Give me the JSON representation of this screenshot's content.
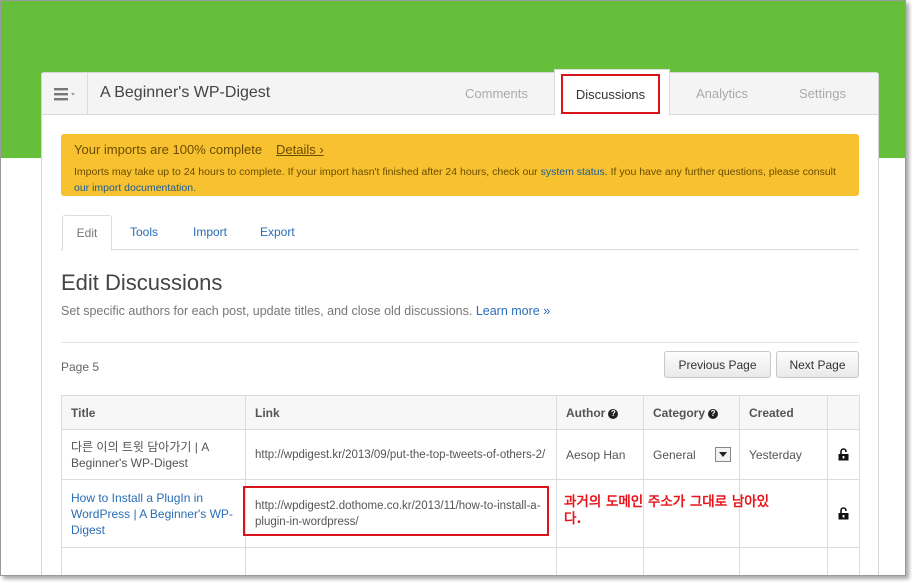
{
  "header": {
    "site_title": "A Beginner's WP-Digest",
    "tabs": [
      {
        "label": "Comments"
      },
      {
        "label": "Discussions"
      },
      {
        "label": "Analytics"
      },
      {
        "label": "Settings"
      }
    ],
    "active_tab": "Discussions"
  },
  "alert": {
    "title": "Your imports are 100% complete",
    "details_link": "Details ›",
    "body_part1": "Imports may take up to 24 hours to complete. If your import hasn't finished after 24 hours, check our ",
    "system_status_link": "system status",
    "body_part2": ". If you have any further questions, please consult ",
    "import_docs_link": "our import documentation",
    "body_part3": ".",
    "background_color": "#f8c12f"
  },
  "subtabs": [
    "Edit",
    "Tools",
    "Import",
    "Export"
  ],
  "heading": {
    "title": "Edit Discussions",
    "description": "Set specific authors for each post, update titles, and close old discussions.",
    "learn_more": "Learn more »"
  },
  "pagination": {
    "page_label": "Page 5",
    "previous": "Previous Page",
    "next": "Next Page"
  },
  "table": {
    "columns": [
      "Title",
      "Link",
      "Author",
      "Category",
      "Created"
    ],
    "rows": [
      {
        "title": "다른 이의 트윗 담아가기 | A Beginner's WP-Digest",
        "link": "http://wpdigest.kr/2013/09/put-the-top-tweets-of-others-2/",
        "author": "Aesop Han",
        "category": "General",
        "created": "Yesterday",
        "lock_icon": "unlock-icon"
      },
      {
        "title": "How to Install a PlugIn in WordPress | A Beginner's WP-Digest",
        "link": "http://wpdigest2.dothome.co.kr/2013/11/how-to-install-a-plugin-in-wordpress/",
        "author": "",
        "category": "",
        "created": "",
        "lock_icon": "unlock-icon"
      }
    ]
  },
  "annotation": {
    "text": "과거의 도메인 주소가 그대로 남아있다.",
    "color": "#e8141a"
  },
  "colors": {
    "brand_green": "#66bf3a",
    "highlight_red": "#d9141a",
    "link_blue": "#2a6db5"
  }
}
